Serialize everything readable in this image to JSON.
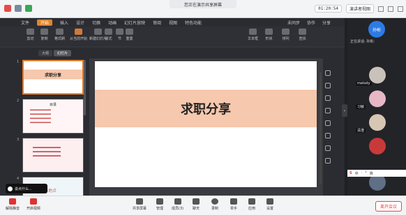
{
  "topbar": {
    "share_status": "您正在演示共享屏幕",
    "timer": "01:20:54",
    "view_button": "演讲者视图"
  },
  "menu": {
    "items": [
      "文件",
      "开始",
      "插入",
      "设计",
      "切换",
      "动画",
      "幻灯片放映",
      "审阅",
      "视图",
      "特色功能"
    ],
    "right_items": [
      "未同步",
      "协作",
      "分享"
    ]
  },
  "ribbon": {
    "items": [
      "剪切",
      "复制",
      "格式刷",
      "从当前开始",
      "新建幻灯片",
      "版式",
      "节",
      "重置",
      "文本框",
      "形状",
      "排列",
      "查找"
    ]
  },
  "panel_tabs": [
    "大纲",
    "幻灯片"
  ],
  "thumbnails": [
    {
      "num": "1",
      "title": "求职分享"
    },
    {
      "num": "2",
      "title": "目录"
    },
    {
      "num": "3",
      "title": ""
    },
    {
      "num": "4",
      "title": "工作地点"
    }
  ],
  "slide": {
    "title": "求职分享"
  },
  "speak_tip": "说点什么...",
  "sidebar": {
    "me": "孙彬",
    "speaking_label": "正在讲话: 孙彬;",
    "participants": [
      {
        "name": "melody",
        "color": "#c9c2bb"
      },
      {
        "name": "习敏",
        "color": "#e7b7c6"
      },
      {
        "name": "清澄",
        "color": "#d7c6b4"
      },
      {
        "name": "",
        "color": "#c83a3a"
      },
      {
        "name": "",
        "color": "#5e6f86"
      }
    ]
  },
  "ime": [
    "S",
    "中",
    "·",
    "°",
    "简"
  ],
  "bottombar": {
    "items": [
      "解除静音",
      "开启视频",
      "共享屏幕",
      "管理",
      "成员(3)",
      "聊天",
      "录制",
      "举手",
      "应用",
      "设置"
    ],
    "leave": "离开会议"
  }
}
